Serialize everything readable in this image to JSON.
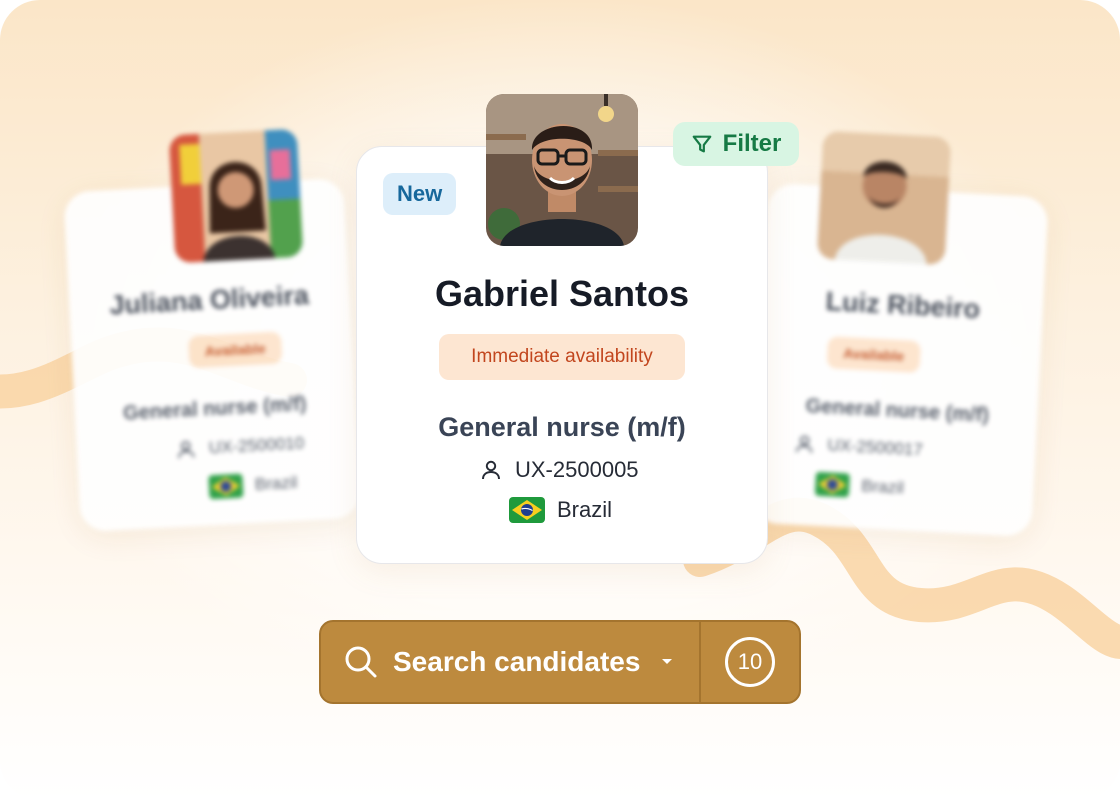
{
  "candidates_left": {
    "name": "Juliana Oliveira",
    "badge": "Available",
    "role": "General nurse (m/f)",
    "id": "UX-2500010",
    "country": "Brazil"
  },
  "candidate_main": {
    "badge": "New",
    "name": "Gabriel Santos",
    "availability": "Immediate availability",
    "role": "General nurse (m/f)",
    "id": "UX-2500005",
    "country": "Brazil"
  },
  "candidates_right": {
    "name": "Luiz Ribeiro",
    "badge": "Available",
    "role": "General nurse (m/f)",
    "id": "UX-2500017",
    "country": "Brazil"
  },
  "filter": {
    "label": "Filter"
  },
  "search": {
    "label": "Search candidates",
    "count": "10"
  },
  "colors": {
    "accent": "#bd8a3e",
    "filter_bg": "#d8f5e3",
    "filter_text": "#167a45",
    "new_bg": "#ddeefa",
    "new_text": "#17689c",
    "availability_bg": "#fde6d2",
    "availability_text": "#c2461e"
  },
  "icons": [
    "filter-icon",
    "user-icon",
    "brazil-flag-icon",
    "search-icon",
    "chevron-down-icon"
  ]
}
